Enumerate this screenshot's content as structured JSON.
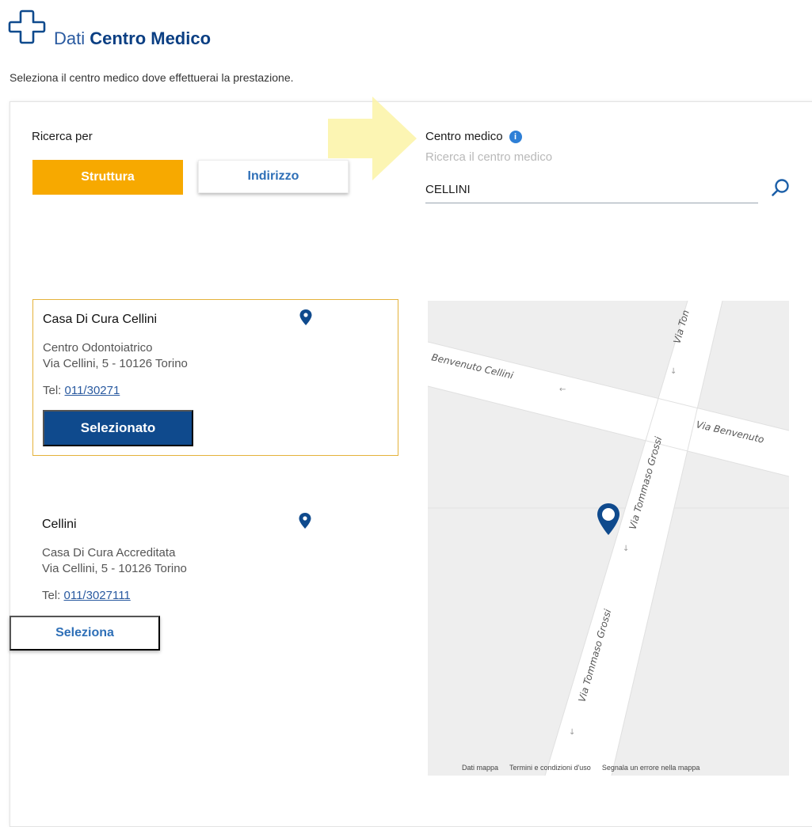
{
  "header": {
    "title_light": "Dati",
    "title_bold": "Centro Medico",
    "subtitle": "Seleziona il centro medico dove effettuerai la prestazione."
  },
  "search": {
    "by_label": "Ricerca per",
    "tabs": [
      {
        "label": "Struttura",
        "active": true
      },
      {
        "label": "Indirizzo",
        "active": false
      }
    ],
    "center_label": "Centro medico",
    "info_icon_glyph": "i",
    "placeholder": "Ricerca il centro medico",
    "value": "CELLINI"
  },
  "results": [
    {
      "name": "Casa Di Cura Cellini",
      "type": "Centro Odontoiatrico",
      "address": "Via Cellini, 5 - 10126 Torino",
      "tel_label": "Tel:",
      "tel": "011/30271",
      "button": "Selezionato",
      "selected": true
    },
    {
      "name": "Cellini",
      "type": "Casa Di Cura Accreditata",
      "address": "Via Cellini, 5 - 10126 Torino",
      "tel_label": "Tel:",
      "tel": "011/3027111",
      "button": "Seleziona",
      "selected": false
    }
  ],
  "map": {
    "streets": [
      "Via Ton",
      "Benvenuto Cellini",
      "Via Tommaso Grossi",
      "Via Benvenuto",
      "Via Tommaso Grossi"
    ],
    "footer": [
      "Dati mappa",
      "Termini e condizioni d'uso",
      "Segnala un errore nella mappa"
    ]
  },
  "colors": {
    "accent_orange": "#f7a900",
    "brand_blue": "#0f4a8d",
    "link_blue": "#2e6fb7",
    "selected_border": "#e4b23a",
    "hint_arrow": "#fbf3a6"
  },
  "icons": {
    "header": "medical-cross-icon",
    "search": "search-icon",
    "pin": "map-pin-icon",
    "info": "info-icon"
  }
}
